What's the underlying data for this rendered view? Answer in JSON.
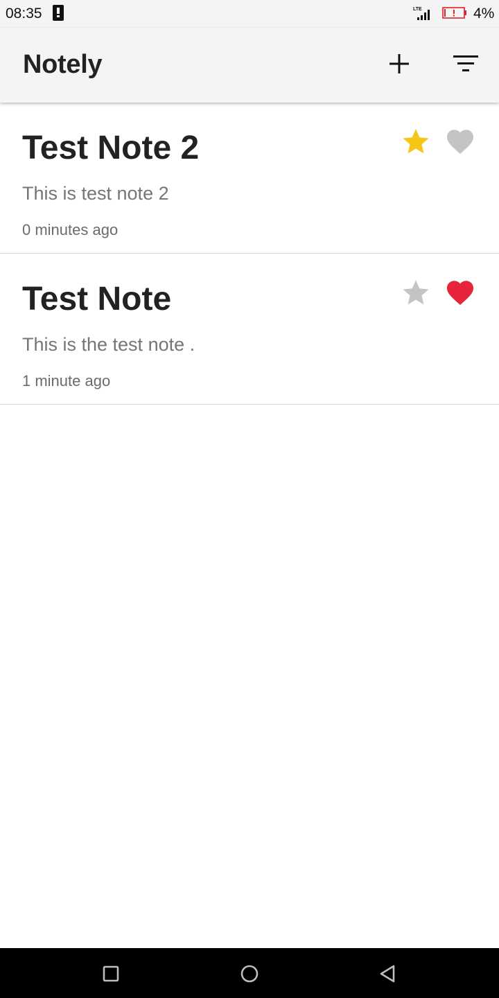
{
  "status_bar": {
    "time": "08:35",
    "battery_percent": "4%",
    "battery_color": "#e0202a",
    "network_label": "LTE",
    "icons": [
      "alert-icon",
      "signal-icon",
      "battery-low-icon"
    ]
  },
  "app_bar": {
    "title": "Notely",
    "actions": [
      "add-icon",
      "filter-icon"
    ]
  },
  "notes": [
    {
      "title": "Test Note 2",
      "body": "This is test note 2",
      "time": "0 minutes ago",
      "starred": true,
      "favorited": false
    },
    {
      "title": "Test Note",
      "body": "This is the test note .",
      "time": "1 minute ago",
      "starred": false,
      "favorited": true
    }
  ],
  "colors": {
    "star_active": "#f5c518",
    "heart_active": "#e6253c",
    "icon_inactive": "#c4c4c4",
    "app_bar_bg": "#f4f4f4"
  },
  "nav_bar": {
    "buttons": [
      "recents-icon",
      "home-icon",
      "back-icon"
    ]
  }
}
